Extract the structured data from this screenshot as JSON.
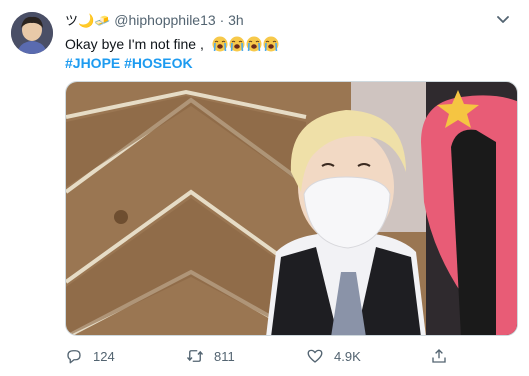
{
  "tweet": {
    "display_name_emoji": "ツ🌙🧈",
    "handle": "@hiphopphile13",
    "separator": "·",
    "timestamp": "3h",
    "text": "Okay bye I'm not fine ,",
    "emoji_names": [
      "loudly-crying-face",
      "loudly-crying-face",
      "loudly-crying-face",
      "loudly-crying-face"
    ],
    "hashtags": [
      "#JHOPE",
      "#HOSEOK"
    ]
  },
  "actions": {
    "reply_count": "124",
    "retweet_count": "811",
    "like_count": "4.9K"
  },
  "colors": {
    "link": "#1d9bf0",
    "meta": "#536471",
    "border": "#cfd9de"
  }
}
